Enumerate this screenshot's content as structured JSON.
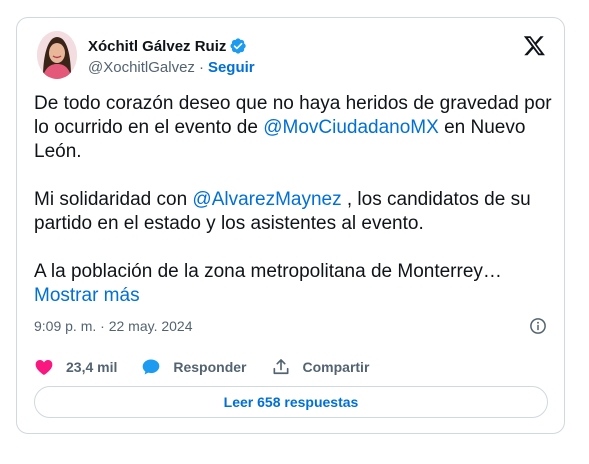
{
  "author": {
    "display_name": "Xóchitl Gálvez Ruiz",
    "handle": "@XochitlGalvez",
    "separator": "·",
    "follow_label": "Seguir",
    "verified_color": "#1d9bf0"
  },
  "tweet": {
    "p1_before": "De todo corazón deseo que no haya heridos de gravedad por lo ocurrido en el evento de ",
    "p1_mention": "@MovCiudadanoMX",
    "p1_after": " en Nuevo León.",
    "p2_before": "Mi solidaridad con ",
    "p2_mention": "@AlvarezMaynez",
    "p2_after": " , los candidatos de su partido en el estado y los asistentes al evento.",
    "p3_text": "A la población de la zona metropolitana de Monterrey… ",
    "show_more": "Mostrar más"
  },
  "meta": {
    "timestamp": "9:09 p. m. · 22 may. 2024"
  },
  "actions": {
    "likes": "23,4 mil",
    "reply_label": "Responder",
    "share_label": "Compartir"
  },
  "read_replies_label": "Leer 658 respuestas",
  "colors": {
    "link": "#006fd6",
    "like": "#f91880",
    "secondary_text": "#536471",
    "border": "#cfd9de"
  }
}
